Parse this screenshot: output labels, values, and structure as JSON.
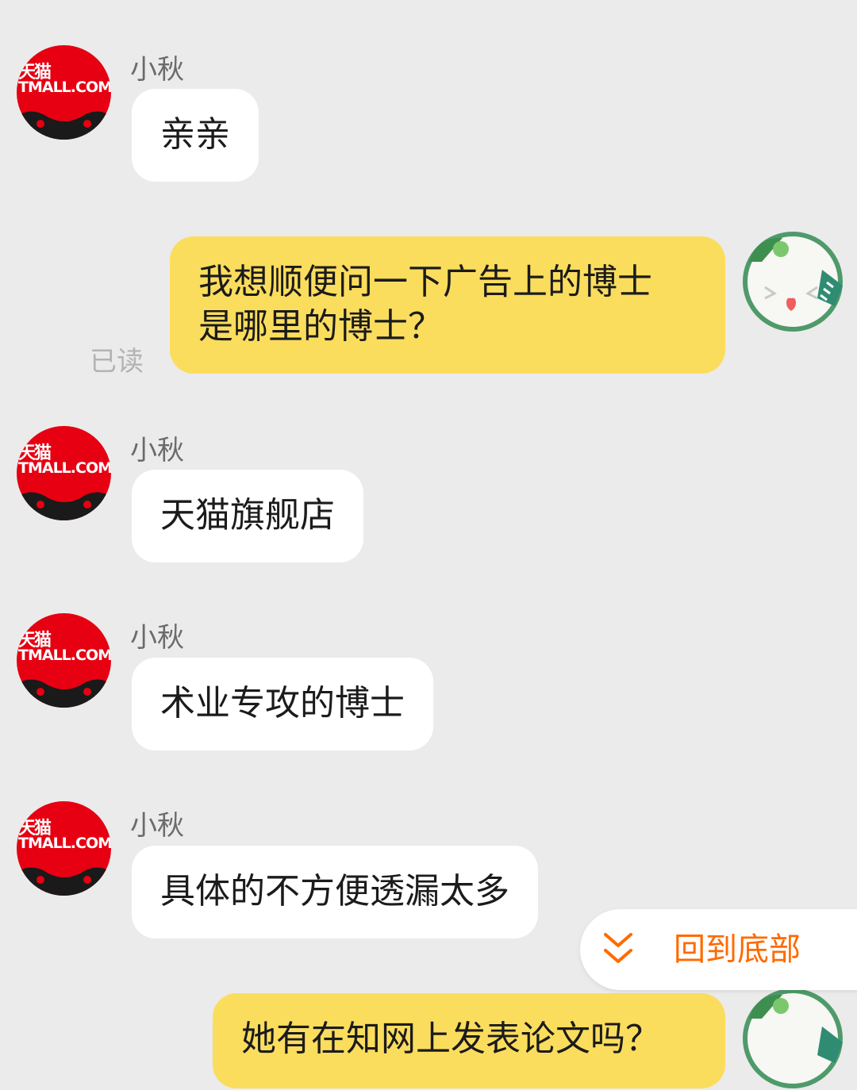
{
  "shop": {
    "name": "小秋",
    "avatar_text_cn": "天猫",
    "avatar_text_en": "TMALL.COM"
  },
  "messages": [
    {
      "from": "shop",
      "text": "亲亲"
    },
    {
      "from": "user",
      "lines": [
        "我想顺便问一下广告上的博士",
        "是哪里的博士？"
      ],
      "status": "已读"
    },
    {
      "from": "shop",
      "text": "天猫旗舰店"
    },
    {
      "from": "shop",
      "text": "术业专攻的博士"
    },
    {
      "from": "shop",
      "text": "具体的不方便透漏太多"
    },
    {
      "from": "user",
      "text": "她有在知网上发表论文吗？"
    }
  ],
  "back_to_bottom": {
    "label": "回到底部"
  },
  "colors": {
    "background": "#ebebeb",
    "user_bubble": "#fbdd5e",
    "shop_bubble": "#ffffff",
    "accent": "#ff6a00",
    "tmall_red": "#e60012"
  },
  "icons": {
    "shop_avatar": "tmall-logo-icon",
    "user_avatar": "cartoon-avatar-icon",
    "back_to_bottom": "double-chevron-down-icon"
  }
}
